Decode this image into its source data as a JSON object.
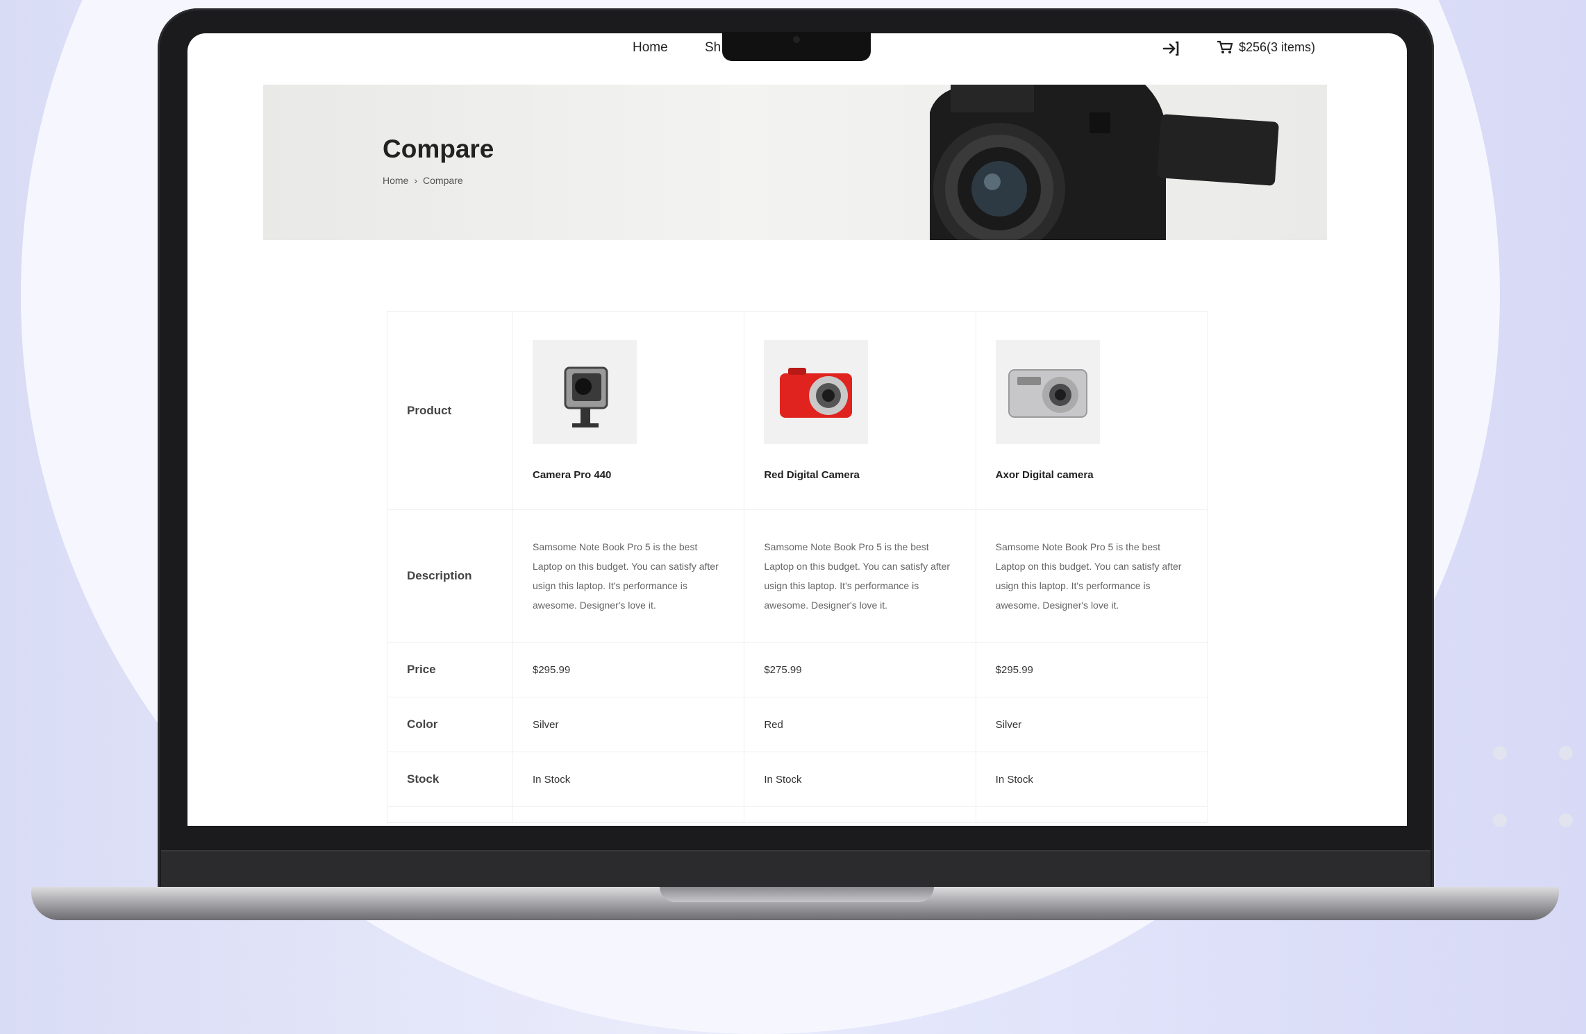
{
  "nav": {
    "home": "Home",
    "shop": "Sh",
    "cart_total": "$256(3 items)"
  },
  "banner": {
    "title": "Compare",
    "breadcrumb": [
      "Home",
      "Compare"
    ]
  },
  "compare": {
    "labels": {
      "product": "Product",
      "description": "Description",
      "price": "Price",
      "color": "Color",
      "stock": "Stock"
    },
    "products": [
      {
        "name": "Camera Pro 440",
        "image_icon": "action-camera-icon",
        "description": "Samsome Note Book Pro 5 is the best Laptop on this budget. You can satisfy after usign this laptop. It's performance is awesome. Designer's love it.",
        "price": "$295.99",
        "color": "Silver",
        "stock": "In Stock"
      },
      {
        "name": "Red Digital Camera",
        "image_icon": "red-compact-camera-icon",
        "description": "Samsome Note Book Pro 5 is the best Laptop on this budget. You can satisfy after usign this laptop. It's performance is awesome. Designer's love it.",
        "price": "$275.99",
        "color": "Red",
        "stock": "In Stock"
      },
      {
        "name": "Axor Digital camera",
        "image_icon": "silver-compact-camera-icon",
        "description": "Samsome Note Book Pro 5 is the best Laptop on this budget. You can satisfy after usign this laptop. It's performance is awesome. Designer's love it.",
        "price": "$295.99",
        "color": "Silver",
        "stock": "In Stock"
      }
    ]
  }
}
